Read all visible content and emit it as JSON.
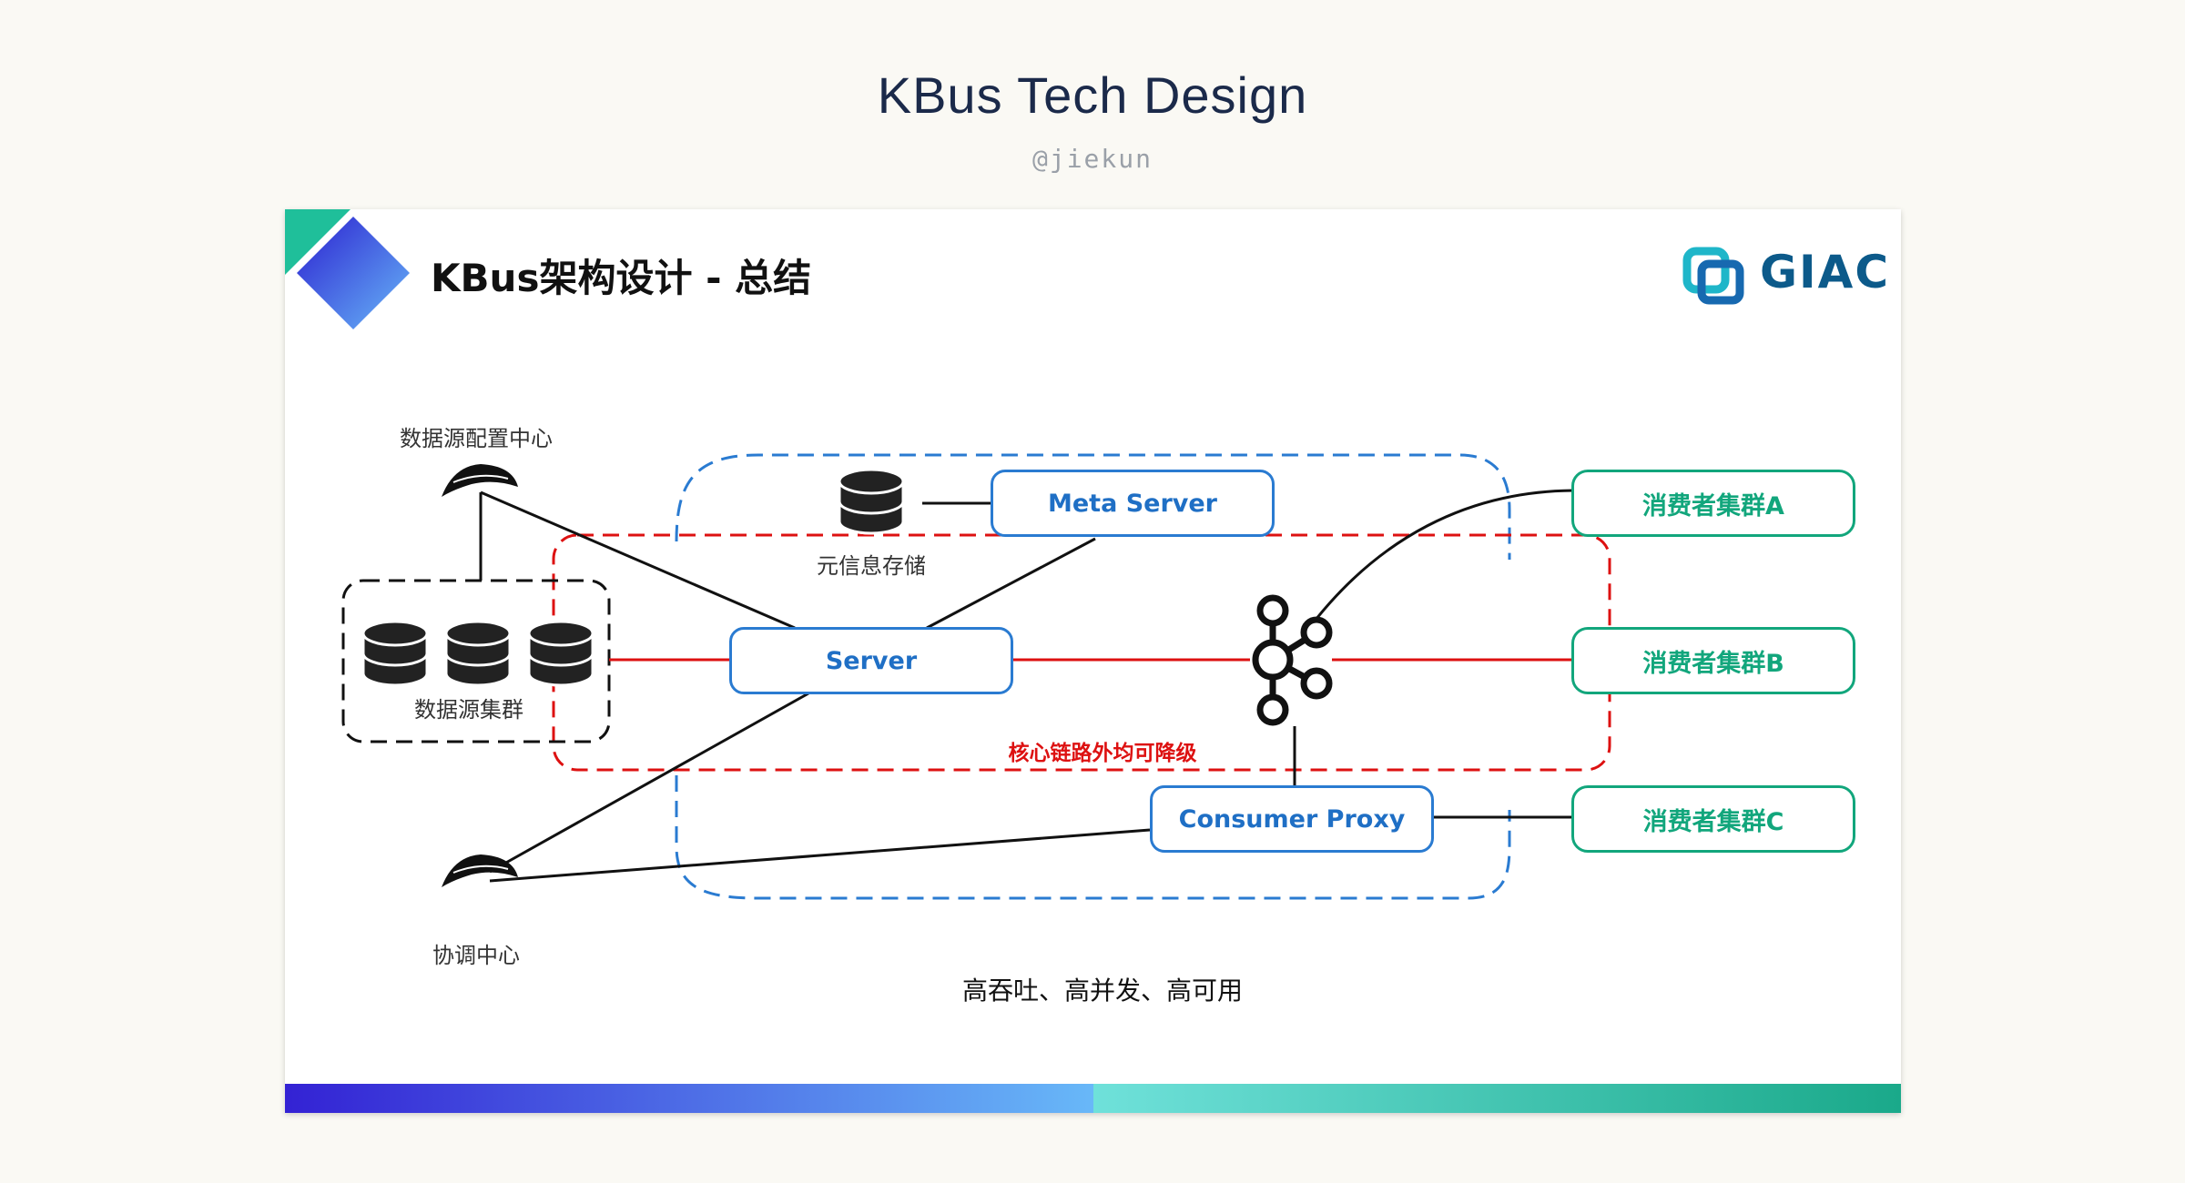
{
  "page": {
    "title": "KBus Tech Design",
    "author": "@jiekun"
  },
  "slide": {
    "title": "KBus架构设计 - 总结",
    "logo_text": "GIAC",
    "nodes": {
      "meta_server": "Meta Server",
      "server": "Server",
      "consumer_proxy": "Consumer Proxy"
    },
    "consumers": [
      "消费者集群A",
      "消费者集群B",
      "消费者集群C"
    ],
    "labels": {
      "datasource_config": "数据源配置中心",
      "meta_storage": "元信息存储",
      "datasource_cluster": "数据源集群",
      "coordinator": "协调中心",
      "degrade_note": "核心链路外均可降级",
      "summary": "高吞吐、高并发、高可用"
    },
    "colors": {
      "accent_blue": "#2a7bd1",
      "consumer_green": "#12a67c",
      "degrade_red": "#dd1111"
    }
  }
}
